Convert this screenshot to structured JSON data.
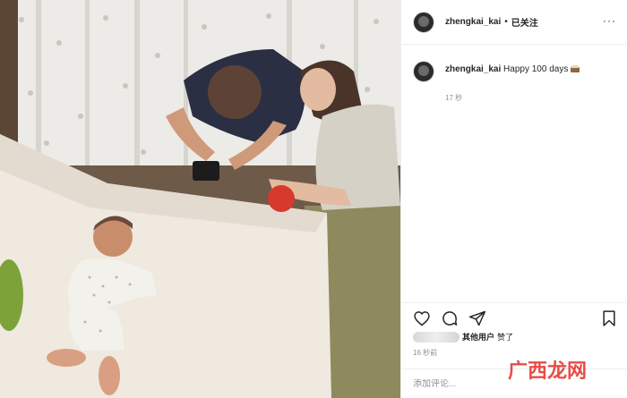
{
  "post": {
    "photo_alt": "Family photographing baby on white blanket",
    "header": {
      "username": "zhengkai_kai",
      "separator": "•",
      "follow_label": "已关注",
      "more_label": "···"
    },
    "caption": {
      "username": "zhengkai_kai",
      "text": "Happy 100 days",
      "emoji_icon": "cake-icon",
      "time": "17 秒"
    },
    "actions": {
      "like_icon": "heart-icon",
      "comment_icon": "comment-icon",
      "share_icon": "share-icon",
      "save_icon": "bookmark-icon"
    },
    "likes": {
      "text": "其他用户",
      "suffix": "赞了"
    },
    "post_time": "16 秒前",
    "comment_placeholder": "添加评论...",
    "watermark": {
      "text": "广西龙网"
    }
  },
  "colors": {
    "text": "#262626",
    "muted": "#8e8e8e",
    "border": "#efefef",
    "watermark": "#e94b46"
  }
}
